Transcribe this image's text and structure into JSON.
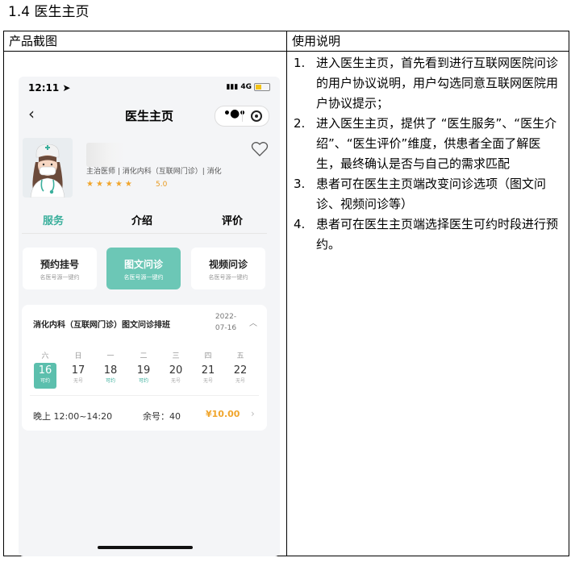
{
  "section": {
    "title": "1.4  医生主页"
  },
  "table": {
    "col1_header": "产品截图",
    "col2_header": "使用说明"
  },
  "phone": {
    "time": "12:11",
    "signal": "4G",
    "nav_title": "医生主页",
    "doctor": {
      "name_partial": "余",
      "meta": "主治医师 | 消化内科（互联网门诊）| 消化",
      "stars": "★★★★★",
      "rating": "5.0"
    },
    "tabs": [
      "服务",
      "介绍",
      "评价"
    ],
    "services": [
      {
        "title": "预约挂号",
        "sub": "名医号源一键约"
      },
      {
        "title": "图文问诊",
        "sub": "名医号源一键约"
      },
      {
        "title": "视频问诊",
        "sub": "名医号源一键约"
      }
    ],
    "schedule": {
      "title": "消化内科（互联网门诊）图文问诊排班",
      "date_line1": "2022-",
      "date_line2": "07-16",
      "days": [
        {
          "weekday": "六",
          "date": "16",
          "status": "可约"
        },
        {
          "weekday": "日",
          "date": "17",
          "status": "无号"
        },
        {
          "weekday": "一",
          "date": "18",
          "status": "可约"
        },
        {
          "weekday": "二",
          "date": "19",
          "status": "可约"
        },
        {
          "weekday": "三",
          "date": "20",
          "status": "无号"
        },
        {
          "weekday": "四",
          "date": "21",
          "status": "无号"
        },
        {
          "weekday": "五",
          "date": "22",
          "status": "无号"
        }
      ],
      "slot_time": "晚上 12:00~14:20",
      "slot_remaining": "余号：40",
      "slot_price": "¥10.00"
    }
  },
  "instructions": [
    {
      "num": "1.",
      "text": "进入医生主页，首先看到进行互联网医院问诊的用户协议说明，用户勾选同意互联网医院用户协议提示；"
    },
    {
      "num": "2.",
      "text": "进入医生主页，提供了 “医生服务”、“医生介绍”、“医生评价”维度，供患者全面了解医生，最终确认是否与自己的需求匹配"
    },
    {
      "num": "3.",
      "text": "患者可在医生主页端改变问诊选项（图文问诊、视频问诊等）"
    },
    {
      "num": "4.",
      "text": "患者可在医生主页端选择医生可约时段进行预约。"
    }
  ]
}
